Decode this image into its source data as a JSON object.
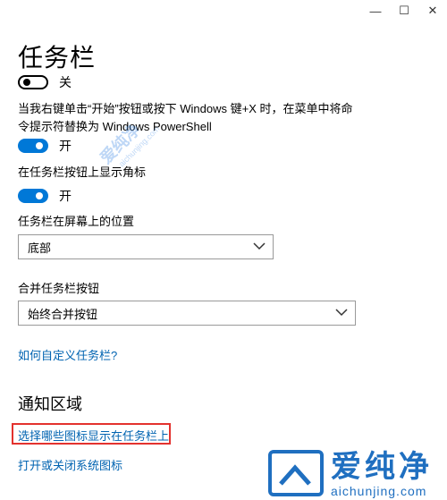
{
  "window": {
    "controls": [
      "—",
      "☐",
      "✕"
    ]
  },
  "title": "任务栏",
  "lock_taskbar": {
    "state_label": "关",
    "on": false
  },
  "powershell_replace": {
    "description": "当我右键单击“开始”按钮或按下 Windows 键+X 时，在菜单中将命令提示符替换为 Windows PowerShell",
    "state_label": "开",
    "on": true
  },
  "show_badges": {
    "description": "在任务栏按钮上显示角标",
    "state_label": "开",
    "on": true
  },
  "taskbar_position": {
    "label": "任务栏在屏幕上的位置",
    "value": "底部"
  },
  "combine_buttons": {
    "label": "合并任务栏按钮",
    "value": "始终合并按钮"
  },
  "customize_link": "如何自定义任务栏?",
  "notification_area": {
    "title": "通知区域",
    "select_icons_link": "选择哪些图标显示在任务栏上",
    "system_icons_link": "打开或关闭系统图标"
  },
  "watermark": {
    "name": "爱纯净",
    "url": "aichunjing.com"
  },
  "colors": {
    "accent": "#0078d7",
    "link": "#0063b1",
    "highlight": "#e3322e",
    "brand": "#1f6fc0"
  }
}
